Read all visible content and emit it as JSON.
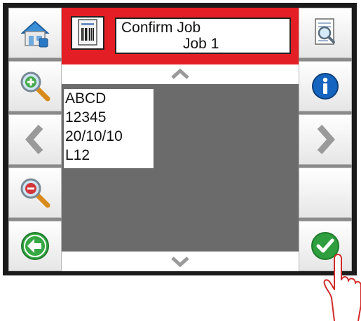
{
  "header": {
    "title": "Confirm Job",
    "job_name": "Job 1"
  },
  "label_preview": {
    "lines": [
      "ABCD",
      "12345",
      "20/10/10",
      "L12"
    ]
  },
  "left_buttons": [
    {
      "name": "home-button",
      "icon": "home-icon"
    },
    {
      "name": "zoom-in-button",
      "icon": "zoom-in-icon"
    },
    {
      "name": "previous-button",
      "icon": "chevron-left-icon"
    },
    {
      "name": "zoom-out-button",
      "icon": "zoom-out-icon"
    },
    {
      "name": "back-button",
      "icon": "back-arrow-icon"
    }
  ],
  "right_buttons": [
    {
      "name": "preview-button",
      "icon": "document-search-icon"
    },
    {
      "name": "info-button",
      "icon": "info-icon"
    },
    {
      "name": "next-button",
      "icon": "chevron-right-icon"
    },
    {
      "name": "blank-button",
      "icon": ""
    },
    {
      "name": "confirm-button",
      "icon": "checkmark-icon"
    }
  ],
  "colors": {
    "header": "#e31e24",
    "bezel": "#1b1b1b",
    "preview_bg": "#6b6b6b",
    "confirm_green": "#2e9e3e",
    "info_blue": "#1565c0"
  }
}
